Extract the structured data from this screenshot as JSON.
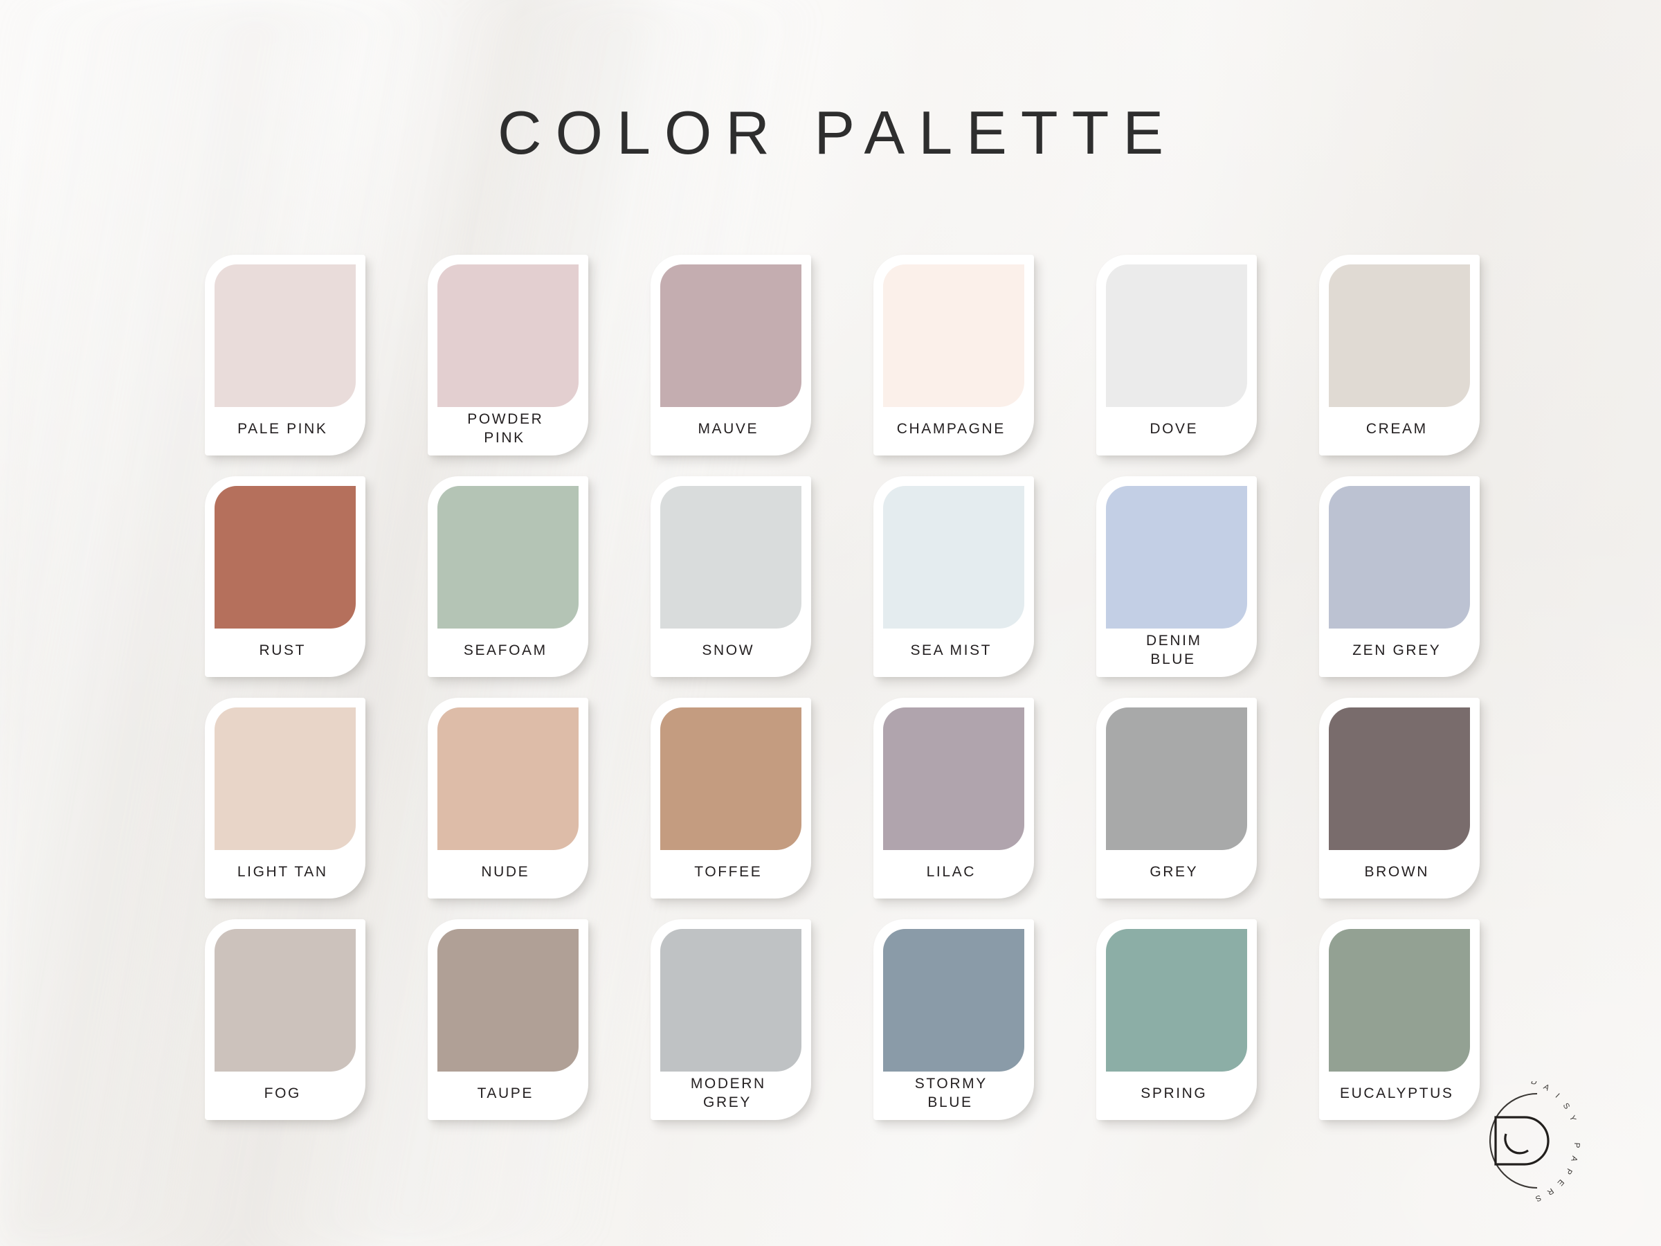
{
  "page": {
    "title": "COLOR PALETTE",
    "background_color": "#F2F0ED",
    "card_color": "#FFFFFF",
    "text_color": "#231F20"
  },
  "brand": {
    "monogram": "D",
    "curved_text": "DAISY PAPERS",
    "letters": [
      "D",
      "A",
      "I",
      "S",
      "Y",
      " ",
      "P",
      "A",
      "P",
      "E",
      "R",
      "S"
    ]
  },
  "palette": {
    "columns": 6,
    "rows": 4,
    "swatches": [
      {
        "name": "PALE PINK",
        "hex": "#E9DCDA"
      },
      {
        "name": "POWDER\nPINK",
        "hex": "#E3CFD0"
      },
      {
        "name": "MAUVE",
        "hex": "#C4ADB0"
      },
      {
        "name": "CHAMPAGNE",
        "hex": "#FBF0EA"
      },
      {
        "name": "DOVE",
        "hex": "#EBEBEB"
      },
      {
        "name": "CREAM",
        "hex": "#E0DAD3"
      },
      {
        "name": "RUST",
        "hex": "#B5705C"
      },
      {
        "name": "SEAFOAM",
        "hex": "#B4C4B5"
      },
      {
        "name": "SNOW",
        "hex": "#D9DCDC"
      },
      {
        "name": "SEA MIST",
        "hex": "#E4ECEF"
      },
      {
        "name": "DENIM\nBLUE",
        "hex": "#C3CFE5"
      },
      {
        "name": "ZEN GREY",
        "hex": "#BCC2D2"
      },
      {
        "name": "LIGHT TAN",
        "hex": "#E8D5C8"
      },
      {
        "name": "NUDE",
        "hex": "#DDBCA8"
      },
      {
        "name": "TOFFEE",
        "hex": "#C49C80"
      },
      {
        "name": "LILAC",
        "hex": "#B0A4AD"
      },
      {
        "name": "GREY",
        "hex": "#A8A9A9"
      },
      {
        "name": "BROWN",
        "hex": "#796C6C"
      },
      {
        "name": "FOG",
        "hex": "#CCC2BC"
      },
      {
        "name": "TAUPE",
        "hex": "#B0A096"
      },
      {
        "name": "MODERN\nGREY",
        "hex": "#BFC2C4"
      },
      {
        "name": "STORMY\nBLUE",
        "hex": "#8A9BA8"
      },
      {
        "name": "SPRING",
        "hex": "#8CAEA6"
      },
      {
        "name": "EUCALYPTUS",
        "hex": "#93A193"
      }
    ]
  }
}
